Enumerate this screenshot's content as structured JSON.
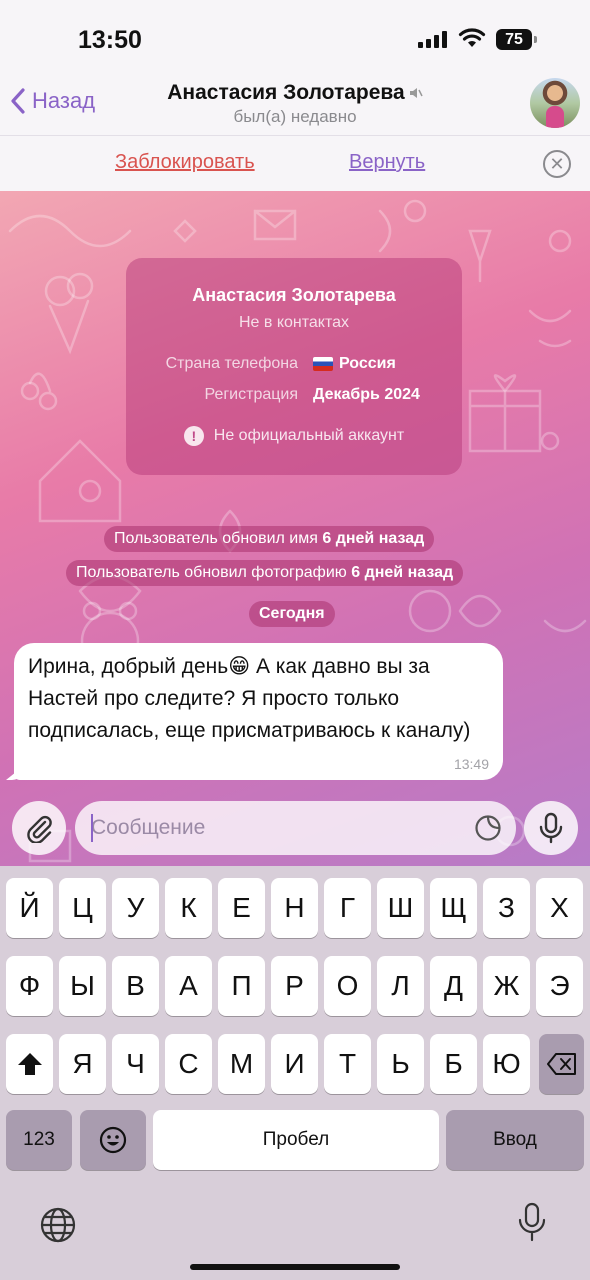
{
  "status_bar": {
    "time": "13:50",
    "battery": "75"
  },
  "header": {
    "back_label": "Назад",
    "title": "Анастасия Золотарева",
    "subtitle": "был(а) недавно"
  },
  "action_bar": {
    "block_label": "Заблокировать",
    "restore_label": "Вернуть"
  },
  "info_card": {
    "name": "Анастасия Золотарева",
    "status": "Не в контактах",
    "phone_country_label": "Страна телефона",
    "phone_country_value": "Россия",
    "registration_label": "Регистрация",
    "registration_value": "Декабрь 2024",
    "warning": "Не официальный аккаунт"
  },
  "service_messages": [
    {
      "text": "Пользователь обновил имя ",
      "highlight": "6 дней назад"
    },
    {
      "text": "Пользователь обновил фотографию ",
      "highlight": "6 дней назад"
    }
  ],
  "date_separator": "Сегодня",
  "message": {
    "text": "Ирина, добрый день😁 А как давно вы за Настей про следите? Я просто только подписалась, еще присматриваюсь к каналу)",
    "time": "13:49"
  },
  "composer": {
    "placeholder": "Сообщение"
  },
  "keyboard": {
    "row1": [
      "Й",
      "Ц",
      "У",
      "К",
      "Е",
      "Н",
      "Г",
      "Ш",
      "Щ",
      "З",
      "Х"
    ],
    "row2": [
      "Ф",
      "Ы",
      "В",
      "А",
      "П",
      "Р",
      "О",
      "Л",
      "Д",
      "Ж",
      "Э"
    ],
    "row3": [
      "Я",
      "Ч",
      "С",
      "М",
      "И",
      "Т",
      "Ь",
      "Б",
      "Ю"
    ],
    "numbers_label": "123",
    "space_label": "Пробел",
    "return_label": "Ввод"
  },
  "colors": {
    "accent": "#8a63c7",
    "danger": "#d9534f"
  }
}
